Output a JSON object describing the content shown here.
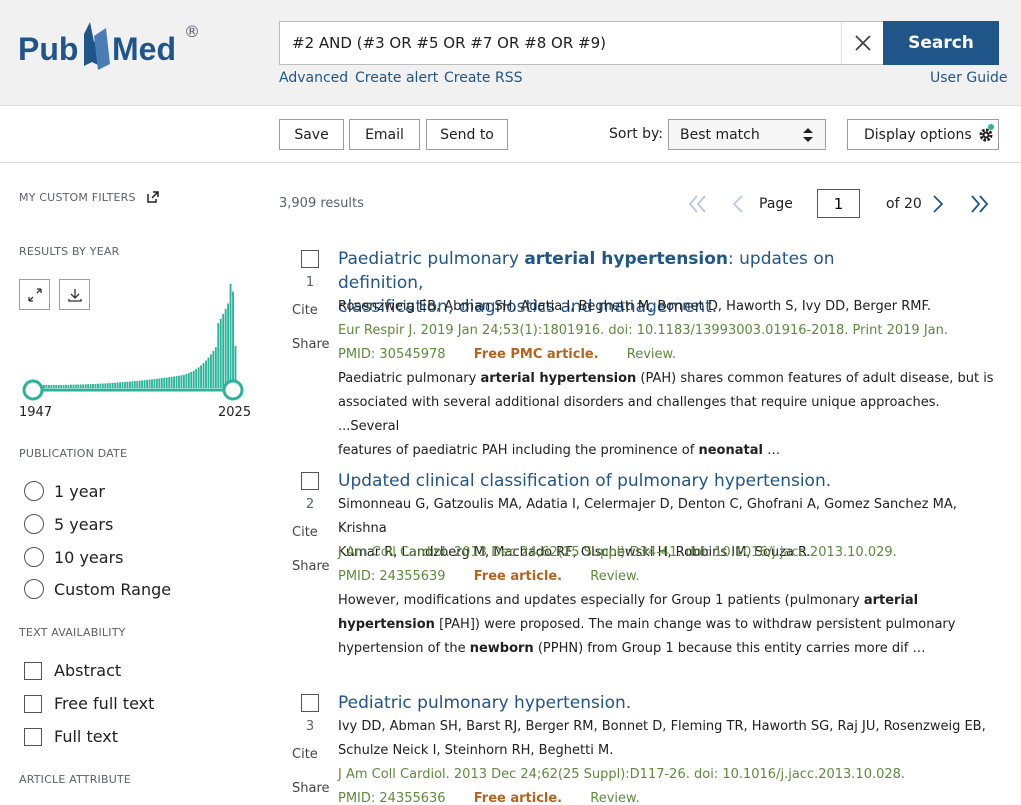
{
  "header": {
    "logo_text": "PubMed",
    "registered_mark": "®",
    "search_value": "#2 AND (#3 OR #5 OR #7 OR #8 OR #9)",
    "search_button": "Search",
    "advanced": "Advanced",
    "create_alert": "Create alert",
    "create_rss": "Create RSS",
    "user_guide": "User Guide"
  },
  "toolbar": {
    "save": "Save",
    "email": "Email",
    "send_to": "Send to",
    "sort_label": "Sort by:",
    "sort_value": "Best match",
    "display_options": "Display options"
  },
  "sidebar": {
    "custom_filters": "MY CUSTOM FILTERS",
    "results_by_year": "RESULTS BY YEAR",
    "year_start": "1947",
    "year_end": "2025",
    "publication_date": "PUBLICATION DATE",
    "date_options": [
      "1 year",
      "5 years",
      "10 years",
      "Custom Range"
    ],
    "text_availability": "TEXT AVAILABILITY",
    "text_options": [
      "Abstract",
      "Free full text",
      "Full text"
    ],
    "article_attribute": "ARTICLE ATTRIBUTE"
  },
  "results": {
    "count": "3,909 results",
    "page_label": "Page",
    "page_value": "1",
    "page_of": "of 20",
    "cite": "Cite",
    "share": "Share",
    "items": [
      {
        "num": "1",
        "title_pre": "Paediatric pulmonary ",
        "title_bold": "arterial hypertension",
        "title_post": ": updates on definition,",
        "title_line2": "classification, diagnostics and management.",
        "authors": "Rosenzweig EB, Abman SH, Adatia I, Beghetti M, Bonnet D, Haworth S, Ivy DD, Berger RMF.",
        "citation": "Eur Respir J. 2019 Jan 24;53(1):1801916. doi: 10.1183/13993003.01916-2018. Print 2019 Jan.",
        "pmid": "PMID: 30545978",
        "free": "Free PMC article.",
        "review": "Review.",
        "snip1_pre": "Paediatric pulmonary ",
        "snip1_bold": "arterial hypertension",
        "snip1_post": " (PAH) shares common features of adult disease, but is",
        "snip2": "associated with several additional disorders and challenges that require unique approaches. ...Several",
        "snip3_pre": "features of paediatric PAH including the prominence of ",
        "snip3_bold": "neonatal",
        "snip3_post": " …"
      },
      {
        "num": "2",
        "title": "Updated clinical classification of pulmonary hypertension.",
        "authors1": "Simonneau G, Gatzoulis MA, Adatia I, Celermajer D, Denton C, Ghofrani A, Gomez Sanchez MA, Krishna",
        "authors2": "Kumar R, Landzberg M, Machado RF, Olschewski H, Robbins IM, Souza R.",
        "citation": "J Am Coll Cardiol. 2013 Dec 24;62(25 Suppl):D34-41. doi: 10.1016/j.jacc.2013.10.029.",
        "pmid": "PMID: 24355639",
        "free": "Free article.",
        "review": "Review.",
        "snip1_pre": "However, modifications and updates especially for Group 1 patients (pulmonary ",
        "snip1_bold": "arterial",
        "snip2_bold": "hypertension",
        "snip2_post": " [PAH]) were proposed. The main change was to withdraw persistent pulmonary",
        "snip3_pre": "hypertension of the ",
        "snip3_bold": "newborn",
        "snip3_post": " (PPHN) from Group 1 because this entity carries more dif …"
      },
      {
        "num": "3",
        "title": "Pediatric pulmonary hypertension.",
        "authors1": "Ivy DD, Abman SH, Barst RJ, Berger RM, Bonnet D, Fleming TR, Haworth SG, Raj JU, Rosenzweig EB,",
        "authors2": "Schulze Neick I, Steinhorn RH, Beghetti M.",
        "citation": "J Am Coll Cardiol. 2013 Dec 24;62(25 Suppl):D117-26. doi: 10.1016/j.jacc.2013.10.028.",
        "pmid": "PMID: 24355636",
        "free": "Free article.",
        "review": "Review."
      }
    ]
  },
  "colors": {
    "brand_blue": "#20558a",
    "histogram_teal": "#2bb39a",
    "free_orange": "#b8621b",
    "citation_green": "#5e8a3c"
  }
}
